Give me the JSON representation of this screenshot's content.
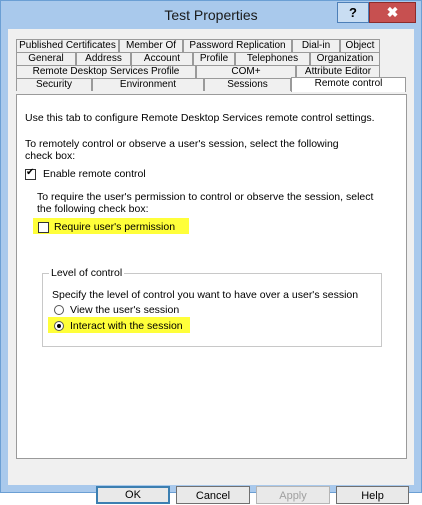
{
  "window": {
    "title": "Test Properties",
    "help_glyph": "?",
    "close_glyph": "✖"
  },
  "tabs": {
    "row1": [
      "Published Certificates",
      "Member Of",
      "Password Replication",
      "Dial-in",
      "Object"
    ],
    "row2": [
      "General",
      "Address",
      "Account",
      "Profile",
      "Telephones",
      "Organization"
    ],
    "row3": [
      "Remote Desktop Services Profile",
      "COM+",
      "Attribute Editor"
    ],
    "row4": [
      "Security",
      "Environment",
      "Sessions",
      "Remote control"
    ],
    "active": "Remote control"
  },
  "panel": {
    "intro": "Use this tab to configure Remote Desktop Services remote control settings.",
    "instruction_line1": "To remotely control or observe a user's session, select the following",
    "instruction_line2": "check box:",
    "enable_remote_control": {
      "label": "Enable remote control",
      "checked": true
    },
    "permission_line1": "To require the user's permission to control or observe the session, select",
    "permission_line2": "the following check box:",
    "require_permission": {
      "label": "Require user's permission",
      "checked": false
    },
    "level_group": {
      "title": "Level of control",
      "description": "Specify the level of control you want to have over a user's session",
      "options": [
        {
          "label": "View the user's session",
          "selected": false
        },
        {
          "label": "Interact with the session",
          "selected": true
        }
      ]
    }
  },
  "buttons": {
    "ok": "OK",
    "cancel": "Cancel",
    "apply": "Apply",
    "help": "Help"
  },
  "colors": {
    "highlight": "#ffff3a",
    "frame": "#a9c9ec",
    "close": "#c75050"
  }
}
